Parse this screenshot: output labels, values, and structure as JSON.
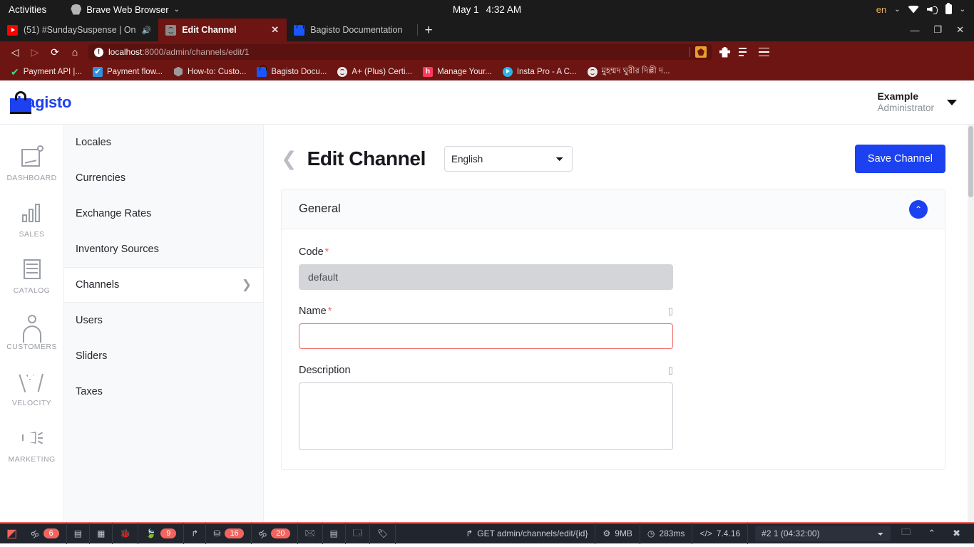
{
  "os_bar": {
    "activities": "Activities",
    "app_name": "Brave Web Browser",
    "app_icon": "brave-lion-icon",
    "date": "May 1",
    "time": "4:32 AM",
    "keyboard_layout": "en",
    "indicators": [
      "wifi-icon",
      "volume-icon",
      "battery-icon",
      "chevron-down-icon"
    ]
  },
  "browser": {
    "tabs": [
      {
        "title": "(51) #SundaySuspense | On",
        "favicon": "youtube-icon",
        "active": false,
        "muted": true
      },
      {
        "title": "Edit Channel",
        "favicon": "globe-icon",
        "active": true,
        "muted": false
      },
      {
        "title": "Bagisto Documentation",
        "favicon": "bagisto-icon",
        "active": false,
        "muted": false
      }
    ],
    "new_tab_label": "+",
    "window_controls": {
      "minimize": "—",
      "maximize": "❐",
      "close": "✕"
    },
    "nav": {
      "back": "back-icon",
      "forward": "forward-icon",
      "reload": "reload-icon",
      "home": "home-icon",
      "bookmark": "bookmark-icon"
    },
    "address": {
      "host": "localhost",
      "path": ":8000/admin/channels/edit/1",
      "security_icon": "info-circle-icon",
      "shield_icon": "brave-shield-icon"
    },
    "toolbar_right": [
      "extensions-puzzle-icon",
      "playlist-icon",
      "hamburger-menu-icon"
    ],
    "bookmarks": [
      {
        "label": "Payment API |...",
        "icon": "green-check-icon"
      },
      {
        "label": "Payment flow...",
        "icon": "blue-check-icon"
      },
      {
        "label": "How-to: Custo...",
        "icon": "hexagon-icon"
      },
      {
        "label": "Bagisto Docu...",
        "icon": "bagisto-icon"
      },
      {
        "label": "A+ (Plus) Certi...",
        "icon": "globe-icon"
      },
      {
        "label": "Manage Your...",
        "icon": "hotjar-icon"
      },
      {
        "label": "Insta Pro - A C...",
        "icon": "play-circle-icon"
      },
      {
        "label": "মুহম্মদ ঘুরীর দিল্লী দ...",
        "icon": "globe-icon"
      }
    ]
  },
  "app": {
    "brand": "bagisto",
    "brand_icon": "shopping-bag-icon",
    "user": {
      "name": "Example",
      "role": "Administrator"
    },
    "rail": [
      {
        "label": "DASHBOARD",
        "icon": "dashboard-icon"
      },
      {
        "label": "SALES",
        "icon": "bar-chart-icon"
      },
      {
        "label": "CATALOG",
        "icon": "list-icon"
      },
      {
        "label": "CUSTOMERS",
        "icon": "user-icon"
      },
      {
        "label": "VELOCITY",
        "icon": "velocity-icon"
      },
      {
        "label": "MARKETING",
        "icon": "megaphone-icon"
      }
    ],
    "submenu": [
      {
        "label": "Locales",
        "active": false
      },
      {
        "label": "Currencies",
        "active": false
      },
      {
        "label": "Exchange Rates",
        "active": false
      },
      {
        "label": "Inventory Sources",
        "active": false
      },
      {
        "label": "Channels",
        "active": true
      },
      {
        "label": "Users",
        "active": false
      },
      {
        "label": "Sliders",
        "active": false
      },
      {
        "label": "Taxes",
        "active": false
      }
    ],
    "page": {
      "back_icon": "chevron-left-icon",
      "title": "Edit Channel",
      "locale_selected": "English",
      "locale_options": [
        "English"
      ],
      "save_label": "Save Channel"
    },
    "panel": {
      "title": "General",
      "collapse_icon": "chevron-up-icon"
    },
    "form": {
      "code": {
        "label": "Code",
        "required": "*",
        "value": "default",
        "readonly": true
      },
      "name": {
        "label": "Name",
        "required": "*",
        "value": "",
        "placeholder": "",
        "locale_glyph": "▯",
        "has_error": true
      },
      "description": {
        "label": "Description",
        "value": "",
        "placeholder": "",
        "locale_glyph": "▯"
      }
    }
  },
  "debugbar": {
    "logo": "laravel-icon",
    "items": [
      {
        "icon": "messages-icon",
        "badge": "6"
      },
      {
        "icon": "view-icon",
        "badge": ""
      },
      {
        "icon": "route-icon",
        "badge": ""
      },
      {
        "icon": "bug-icon",
        "badge": ""
      },
      {
        "icon": "leaf-icon",
        "badge": "9"
      },
      {
        "icon": "redirect-icon",
        "badge": ""
      },
      {
        "icon": "database-icon",
        "badge": "16"
      },
      {
        "icon": "models-icon",
        "badge": "20"
      },
      {
        "icon": "mail-icon",
        "badge": ""
      },
      {
        "icon": "session-icon",
        "badge": ""
      },
      {
        "icon": "request-icon",
        "badge": ""
      },
      {
        "icon": "tags-icon",
        "badge": ""
      }
    ],
    "route": "GET admin/channels/edit/{id}",
    "route_icon": "arrow-icon",
    "memory": "9MB",
    "memory_icon": "gears-icon",
    "time": "283ms",
    "time_icon": "clock-icon",
    "php_version": "7.4.16",
    "php_icon": "code-icon",
    "request_selected": "#2 1 (04:32:00)",
    "request_options": [
      "#2 1 (04:32:00)"
    ],
    "controls": [
      "folder-icon",
      "chevron-up-icon",
      "close-icon"
    ]
  }
}
